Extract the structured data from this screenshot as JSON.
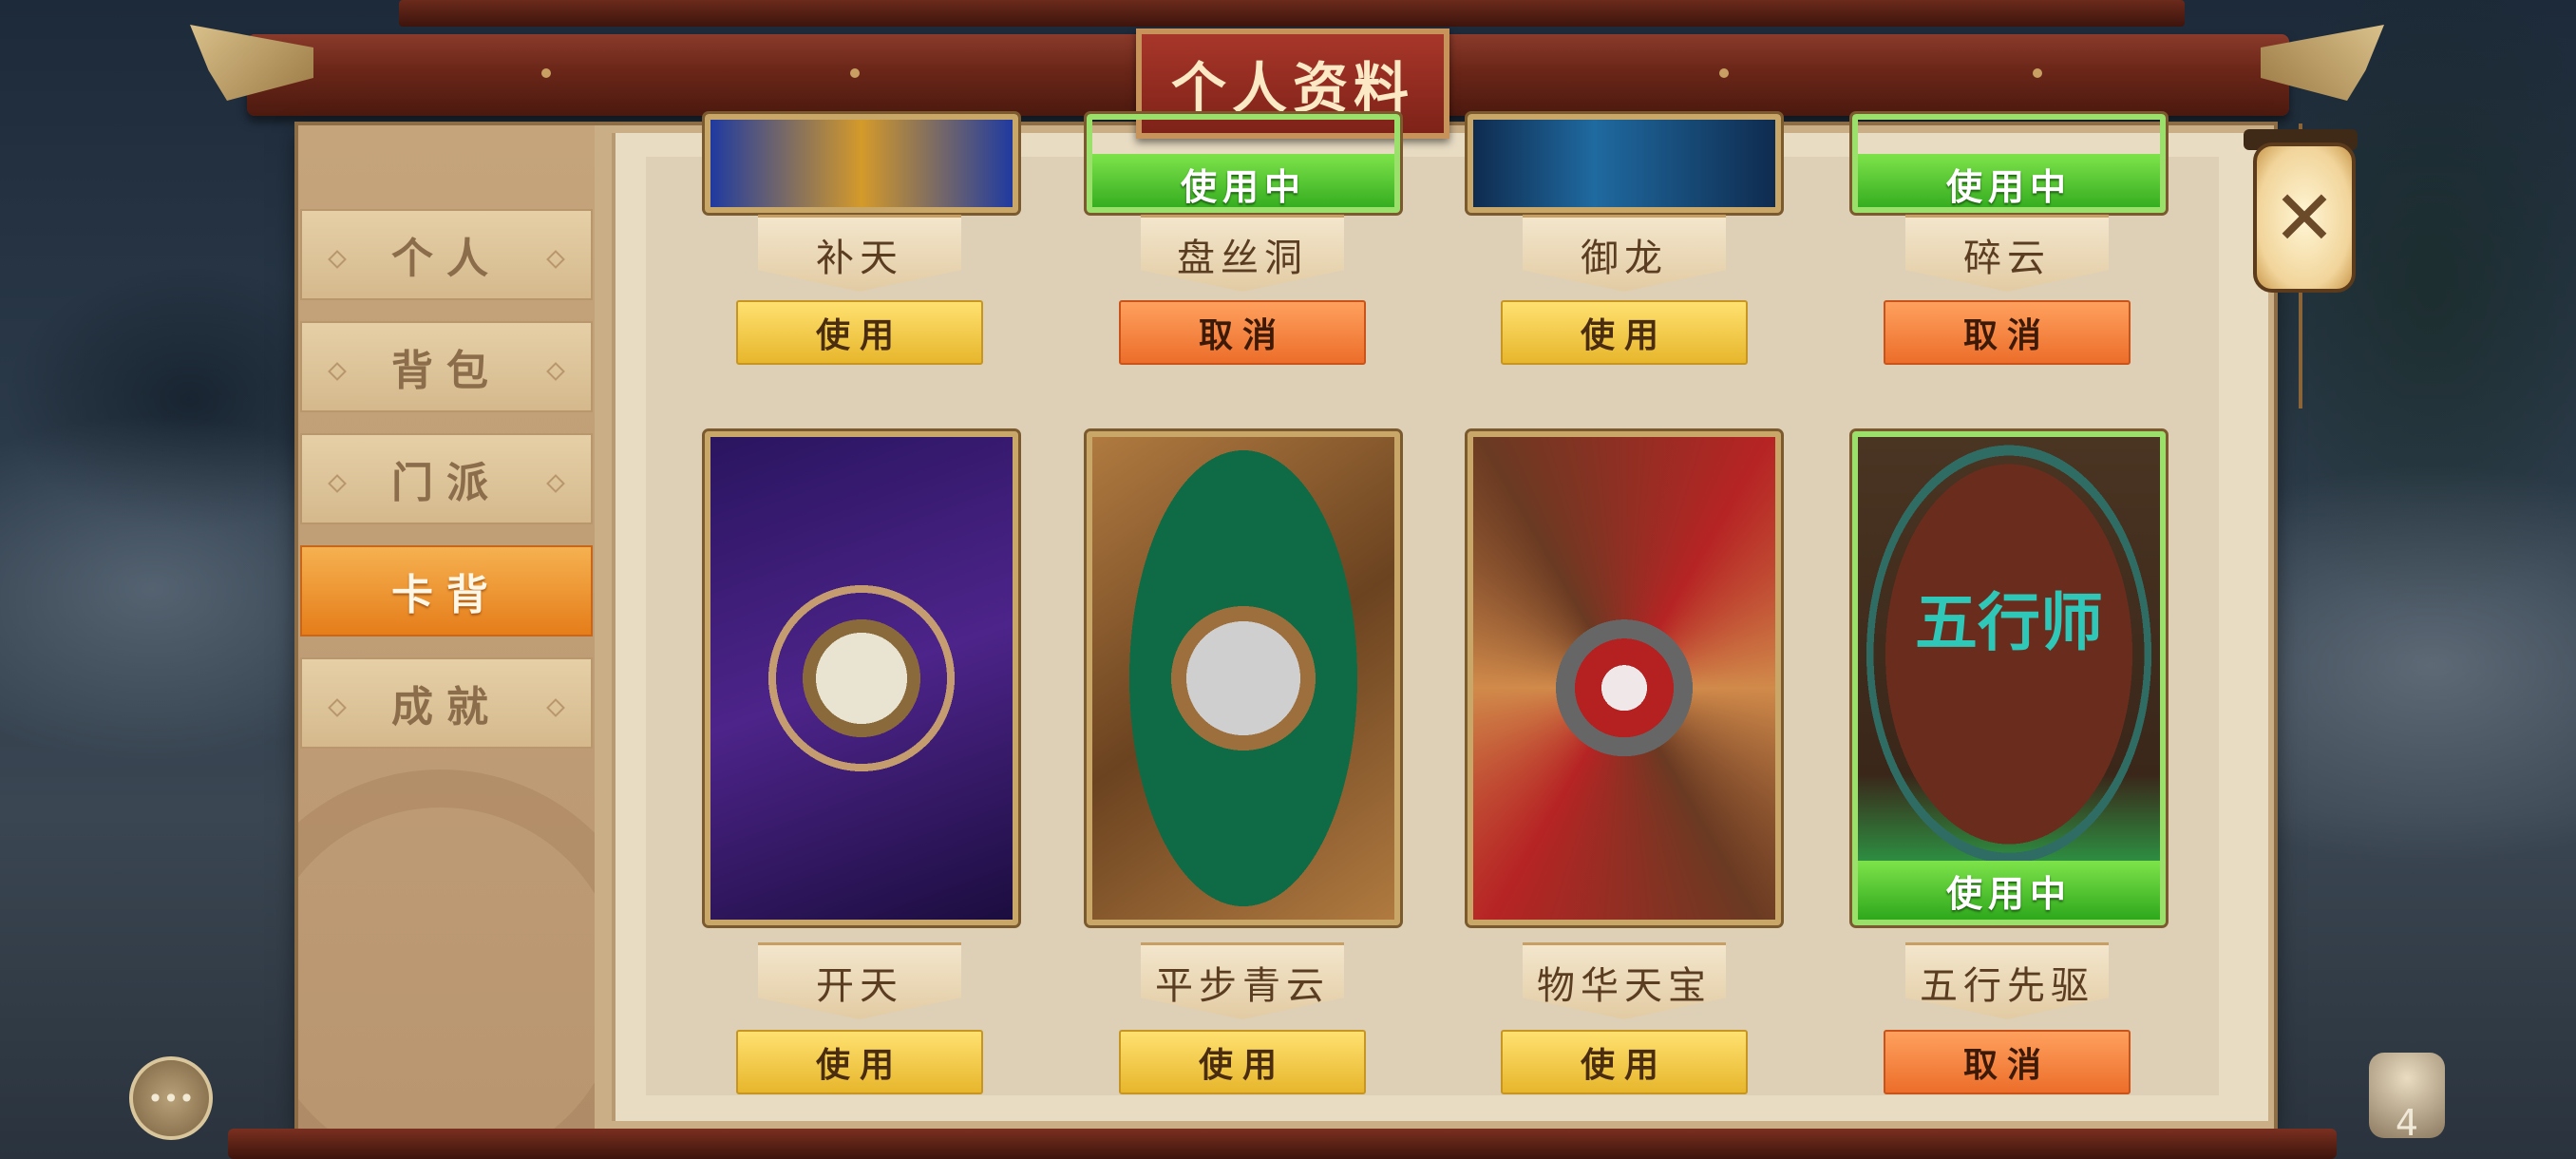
{
  "window": {
    "title": "个人资料"
  },
  "sidebar": {
    "items": [
      {
        "label": "个人",
        "active": false
      },
      {
        "label": "背包",
        "active": false
      },
      {
        "label": "门派",
        "active": false
      },
      {
        "label": "卡背",
        "active": true
      },
      {
        "label": "成就",
        "active": false
      }
    ]
  },
  "cards_top_row": [
    {
      "name": "补天",
      "in_use": false,
      "button": "使用"
    },
    {
      "name": "盘丝洞",
      "in_use": true,
      "status": "使用中",
      "button": "取消"
    },
    {
      "name": "御龙",
      "in_use": false,
      "button": "使用"
    },
    {
      "name": "碎云",
      "in_use": true,
      "status": "使用中",
      "button": "取消"
    }
  ],
  "cards_bottom_row": [
    {
      "name": "开天",
      "in_use": false,
      "button": "使用"
    },
    {
      "name": "平步青云",
      "in_use": false,
      "button": "使用"
    },
    {
      "name": "物华天宝",
      "in_use": false,
      "button": "使用"
    },
    {
      "name": "五行先驱",
      "in_use": true,
      "status": "使用中",
      "button": "取消",
      "art_text": "五行师"
    }
  ],
  "close": {
    "icon": "close-icon",
    "glyph": "✕"
  },
  "chat": {
    "icon": "chat-icon",
    "glyph": "•••"
  },
  "bag": {
    "icon": "bag-icon",
    "count": "4"
  },
  "colors": {
    "use_button": "#f2c94c",
    "cancel_button": "#f28a3e",
    "in_use_badge": "#4cd13a",
    "active_tab": "#ef9a2e"
  }
}
